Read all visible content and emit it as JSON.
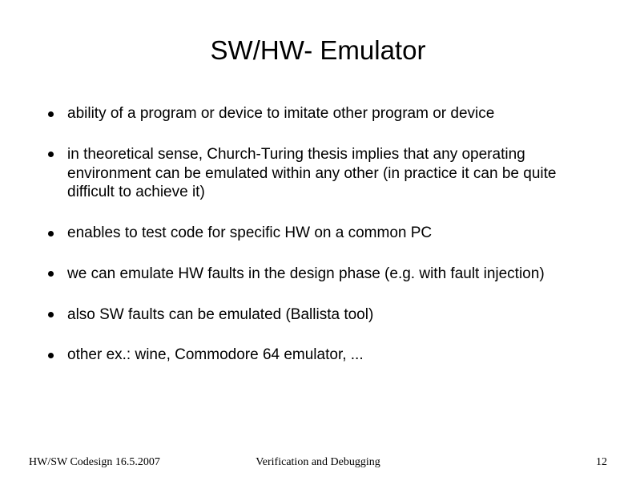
{
  "title": "SW/HW- Emulator",
  "bullets": [
    "ability of a program or device to imitate other program or device",
    "in theoretical sense, Church-Turing thesis implies that any operating environment can be emulated within any other (in practice it can be quite difficult to achieve it)",
    "enables to test code for specific HW on a common PC",
    "we can emulate HW faults in the design phase (e.g. with fault injection)",
    "also SW faults can be emulated (Ballista tool)",
    "other ex.: wine,  Commodore 64 emulator, ..."
  ],
  "footer": {
    "left": "HW/SW Codesign 16.5.2007",
    "center": "Verification and Debugging",
    "right": "12"
  }
}
